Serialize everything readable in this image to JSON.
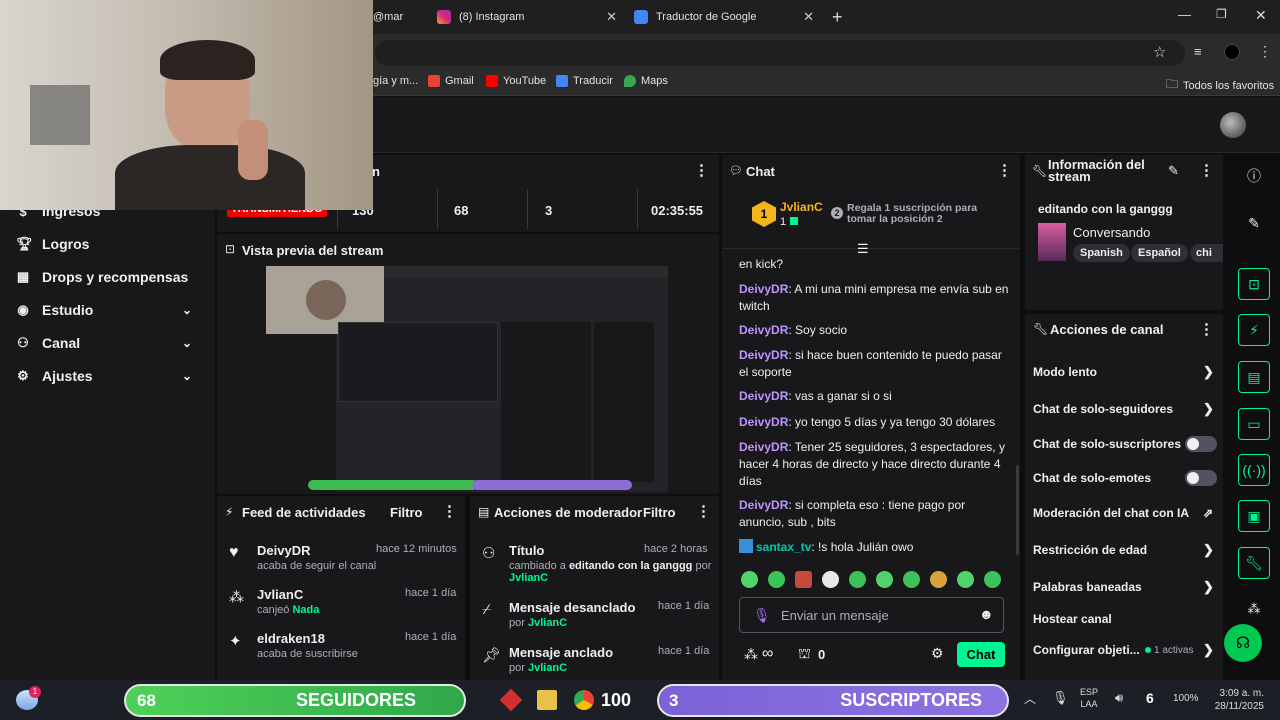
{
  "browser": {
    "tabs": [
      {
        "label": "@mar",
        "active": false
      },
      {
        "label": "(8) Instagram",
        "active": false
      },
      {
        "label": "Traductor de Google",
        "active": false
      }
    ],
    "bookmarks": [
      "gía y m...",
      "Gmail",
      "YouTube",
      "Traducir",
      "Maps"
    ],
    "all_bookmarks": "Todos los favoritos"
  },
  "sidebar": {
    "items": [
      {
        "label": "Ingresos",
        "icon": "money-icon"
      },
      {
        "label": "Logros",
        "icon": "trophy-icon"
      },
      {
        "label": "Drops y recompensas",
        "icon": "gift-icon"
      },
      {
        "label": "Estudio",
        "icon": "studio-icon"
      },
      {
        "label": "Canal",
        "icon": "channel-icon"
      },
      {
        "label": "Ajustes",
        "icon": "gear-icon"
      }
    ]
  },
  "stats": {
    "title_partial": "n",
    "status": "TRANSMITIENDO",
    "viewers": "130",
    "followers": "68",
    "subs": "3",
    "uptime": "02:35:55"
  },
  "preview": {
    "title": "Vista previa del stream"
  },
  "feed": {
    "title": "Feed de actividades",
    "filter": "Filtro",
    "items": [
      {
        "name": "DeivyDR",
        "time": "hace 12 minutos",
        "sub": "acaba de seguir el canal",
        "extra": ""
      },
      {
        "name": "JvlianC",
        "time": "hace 1 día",
        "sub": "canjeó",
        "extra": "Nada"
      },
      {
        "name": "eldraken18",
        "time": "hace 1 día",
        "sub": "acaba de suscribirse",
        "extra": ""
      }
    ]
  },
  "mod": {
    "title": "Acciones de moderador",
    "filter": "Filtro",
    "items": [
      {
        "name": "Título",
        "time": "hace 2 horas",
        "line1_pre": "cambiado a",
        "line1_bold": "editando con la ganggg",
        "line1_post": "por",
        "user": "JvlianC"
      },
      {
        "name": "Mensaje desanclado",
        "time": "hace 1 día",
        "line1_pre": "por",
        "user": "JvlianC"
      },
      {
        "name": "Mensaje anclado",
        "time": "hace 1 día",
        "line1_pre": "por",
        "user": "JvlianC"
      }
    ]
  },
  "chat": {
    "title": "Chat",
    "top_user": "JvlianC",
    "top_count": "1",
    "gift_rank": "2",
    "gift_text": "Regala 1 suscripción para tomar la posición 2",
    "messages": [
      {
        "user": "",
        "text": "en kick?"
      },
      {
        "user": "DeivyDR",
        "text": ": A mi una mini empresa me envía sub en twitch"
      },
      {
        "user": "DeivyDR",
        "text": ": Soy socio"
      },
      {
        "user": "DeivyDR",
        "text": ": si hace buen contenido te puedo pasar el soporte"
      },
      {
        "user": "DeivyDR",
        "text": ": vas a ganar si o si"
      },
      {
        "user": "DeivyDR",
        "text": ": yo tengo 5 días y ya tengo 30 dólares"
      },
      {
        "user": "DeivyDR",
        "text": ": Tener 25 seguidores, 3 espectadores, y hacer 4 horas de directo y hace directo durante 4 días"
      },
      {
        "user": "DeivyDR",
        "text": ": si completa eso : tiene pago por anuncio, sub , bits"
      },
      {
        "user": "santax_tv",
        "text": ": !s hola Julián owo"
      }
    ],
    "input_placeholder": "Enviar un mensaje",
    "infinity": "∞",
    "points": "0",
    "send": "Chat"
  },
  "info": {
    "title": "Información del stream",
    "stream_title": "editando con la ganggg",
    "category": "Conversando",
    "tags": [
      "Spanish",
      "Español",
      "chi"
    ]
  },
  "actions": {
    "title": "Acciones de canal",
    "items": [
      {
        "label": "Modo lento",
        "control": "arrow"
      },
      {
        "label": "Chat de solo-seguidores",
        "control": "arrow"
      },
      {
        "label": "Chat de solo-suscriptores",
        "control": "toggle"
      },
      {
        "label": "Chat de solo-emotes",
        "control": "toggle"
      },
      {
        "label": "Moderación del chat con IA",
        "control": "external"
      },
      {
        "label": "Restricción de edad",
        "control": "arrow"
      },
      {
        "label": "Palabras baneadas",
        "control": "arrow"
      },
      {
        "label": "Hostear canal",
        "control": "none"
      },
      {
        "label": "Configurar objeti...",
        "control": "arrow"
      }
    ],
    "goal_active": "1 activas"
  },
  "taskbar": {
    "followers_count": "68",
    "followers_label": "SEGUIDORES",
    "subs_count": "3",
    "subs_label": "SUSCRIPTORES",
    "badge_count": "100",
    "lang": "ESP",
    "lang2": "LAA",
    "battery": "100%",
    "notif": "6",
    "time": "3:09 a. m.",
    "date": "28/11/2025",
    "notif_badge": "1"
  },
  "colors": {
    "accent": "#00f593",
    "purple": "#bf94ff",
    "live": "#eb0400"
  }
}
